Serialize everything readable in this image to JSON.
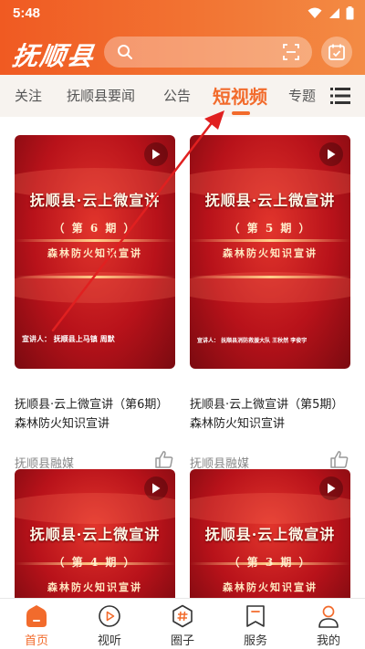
{
  "status_bar": {
    "time": "5:48"
  },
  "app": {
    "logo": "抚顺县"
  },
  "tabs": [
    {
      "label": "关注"
    },
    {
      "label": "抚顺县要闻"
    },
    {
      "label": "公告"
    },
    {
      "label": "短视频"
    },
    {
      "label": "专题"
    }
  ],
  "active_tab": "短视频",
  "cards": [
    {
      "thumb_title": "抚顺县·云上微宣讲",
      "thumb_issue": "（ 第 6 期 ）",
      "thumb_topic": "森林防火知识宣讲",
      "thumb_speaker": "宣讲人： 抚顺县上马镇  周默",
      "title": "抚顺县·云上微宣讲（第6期）森林防火知识宣讲",
      "source": "抚顺县融媒"
    },
    {
      "thumb_title": "抚顺县·云上微宣讲",
      "thumb_issue": "（ 第 5 期 ）",
      "thumb_topic": "森林防火知识宣讲",
      "thumb_speaker": "宣讲人： 抚顺县消防救援大队  王秋然  李俊宇",
      "title": "抚顺县·云上微宣讲（第5期）森林防火知识宣讲",
      "source": "抚顺县融媒"
    },
    {
      "thumb_title": "抚顺县·云上微宣讲",
      "thumb_issue": "（ 第 4 期 ）",
      "thumb_topic": "森林防火知识宣讲"
    },
    {
      "thumb_title": "抚顺县·云上微宣讲",
      "thumb_issue": "（ 第 3 期 ）",
      "thumb_topic": "森林防火知识宣讲"
    }
  ],
  "bottom_nav": [
    {
      "label": "首页",
      "icon": "home-icon"
    },
    {
      "label": "视听",
      "icon": "play-circle-icon"
    },
    {
      "label": "圈子",
      "icon": "hashtag-icon"
    },
    {
      "label": "服务",
      "icon": "bookmark-icon"
    },
    {
      "label": "我的",
      "icon": "profile-icon"
    }
  ],
  "colors": {
    "brand": "#f26b2c",
    "header_start": "#f05a22",
    "annotation": "#e02020"
  }
}
